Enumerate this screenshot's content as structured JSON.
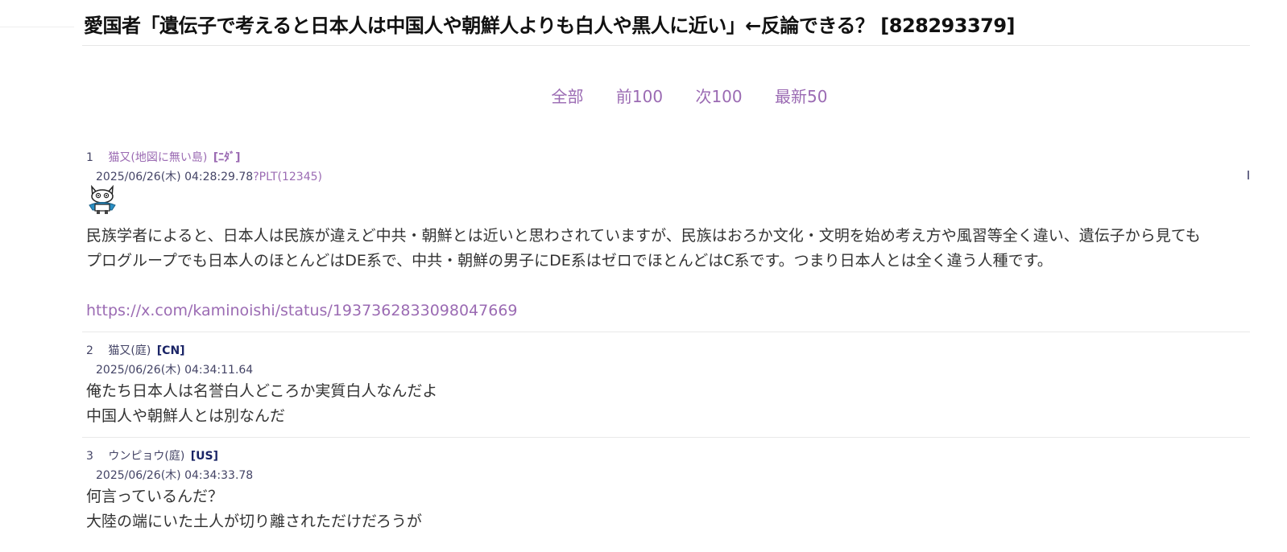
{
  "thread": {
    "title": "愛国者「遺伝子で考えると日本人は中国人や朝鮮人よりも白人や黒人に近い」←反論できる？ [828293379]"
  },
  "pager": {
    "all": "全部",
    "prev": "前100",
    "next": "次100",
    "latest": "最新50"
  },
  "posts": [
    {
      "num": "1",
      "name": "猫又(地図に無い島)",
      "country": "[ﾆﾀﾞ]",
      "date": "2025/06/26(木) 04:28:29.78",
      "id": "?PLT(12345)",
      "icon": "cat-icon",
      "lines": [
        "民族学者によると、日本人は民族が違えど中共・朝鮮とは近いと思わされていますが、民族はおろか文化・文明を始め考え方や風習等全く違い、遺伝子から見ても",
        "プログループでも日本人のほとんどはDE系で、中共・朝鮮の男子にDE系はゼロでほとんどはC系です。つまり日本人とは全く違う人種です。"
      ],
      "link": "https://x.com/kaminoishi/status/1937362833098047669"
    },
    {
      "num": "2",
      "name": "猫又(庭)",
      "country": "[CN]",
      "date": "2025/06/26(木) 04:34:11.64",
      "lines": [
        "俺たち日本人は名誉白人どころか実質白人なんだよ",
        "中国人や朝鮮人とは別なんだ"
      ]
    },
    {
      "num": "3",
      "name": "ウンピョウ(庭)",
      "country": "[US]",
      "date": "2025/06/26(木) 04:34:33.78",
      "lines": [
        "何言っているんだ？",
        "大陸の端にいた土人が切り離されただけだろうが"
      ]
    }
  ],
  "colors": {
    "link": "#9b6bb3",
    "meta": "#444466",
    "country": "#1a2466",
    "text": "#333333"
  }
}
